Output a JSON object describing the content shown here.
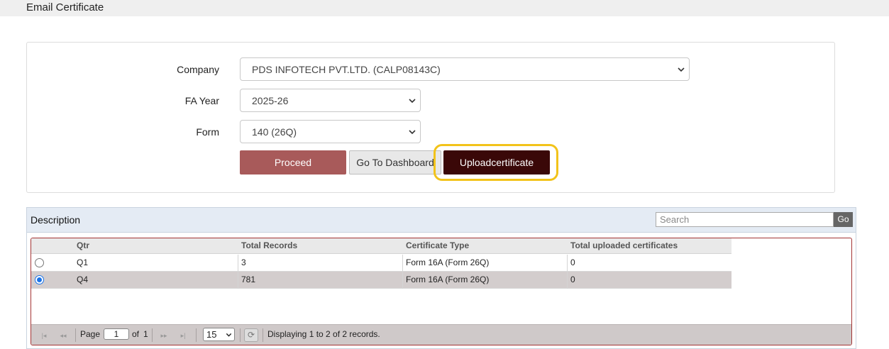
{
  "page": {
    "title": "Email Certificate"
  },
  "form": {
    "company": {
      "label": "Company",
      "value": "PDS INFOTECH PVT.LTD. (CALP08143C)"
    },
    "fa_year": {
      "label": "FA Year",
      "value": "2025-26"
    },
    "form": {
      "label": "Form",
      "value": "140 (26Q)"
    },
    "buttons": {
      "proceed": "Proceed",
      "dashboard": "Go To Dashboard",
      "upload": "Uploadcertificate"
    }
  },
  "grid": {
    "caption": "Description",
    "search": {
      "placeholder": "Search",
      "button": "Go"
    },
    "columns": [
      "Qtr",
      "Total Records",
      "Certificate Type",
      "Total uploaded certificates"
    ],
    "rows": [
      {
        "qtr": "Q1",
        "total": "3",
        "type": "Form 16A (Form 26Q)",
        "uploaded": "0",
        "selected": false
      },
      {
        "qtr": "Q4",
        "total": "781",
        "type": "Form 16A (Form 26Q)",
        "uploaded": "0",
        "selected": true
      }
    ],
    "pager": {
      "page_label": "Page",
      "page": "1",
      "of_label": "of",
      "total_pages": "1",
      "page_size": "15",
      "info": "Displaying 1 to 2 of 2 records."
    }
  },
  "colors": {
    "highlight": "#f2c31a",
    "proceed": "#a85a5a",
    "upload": "#3a0808",
    "grid_border": "#a33434"
  }
}
